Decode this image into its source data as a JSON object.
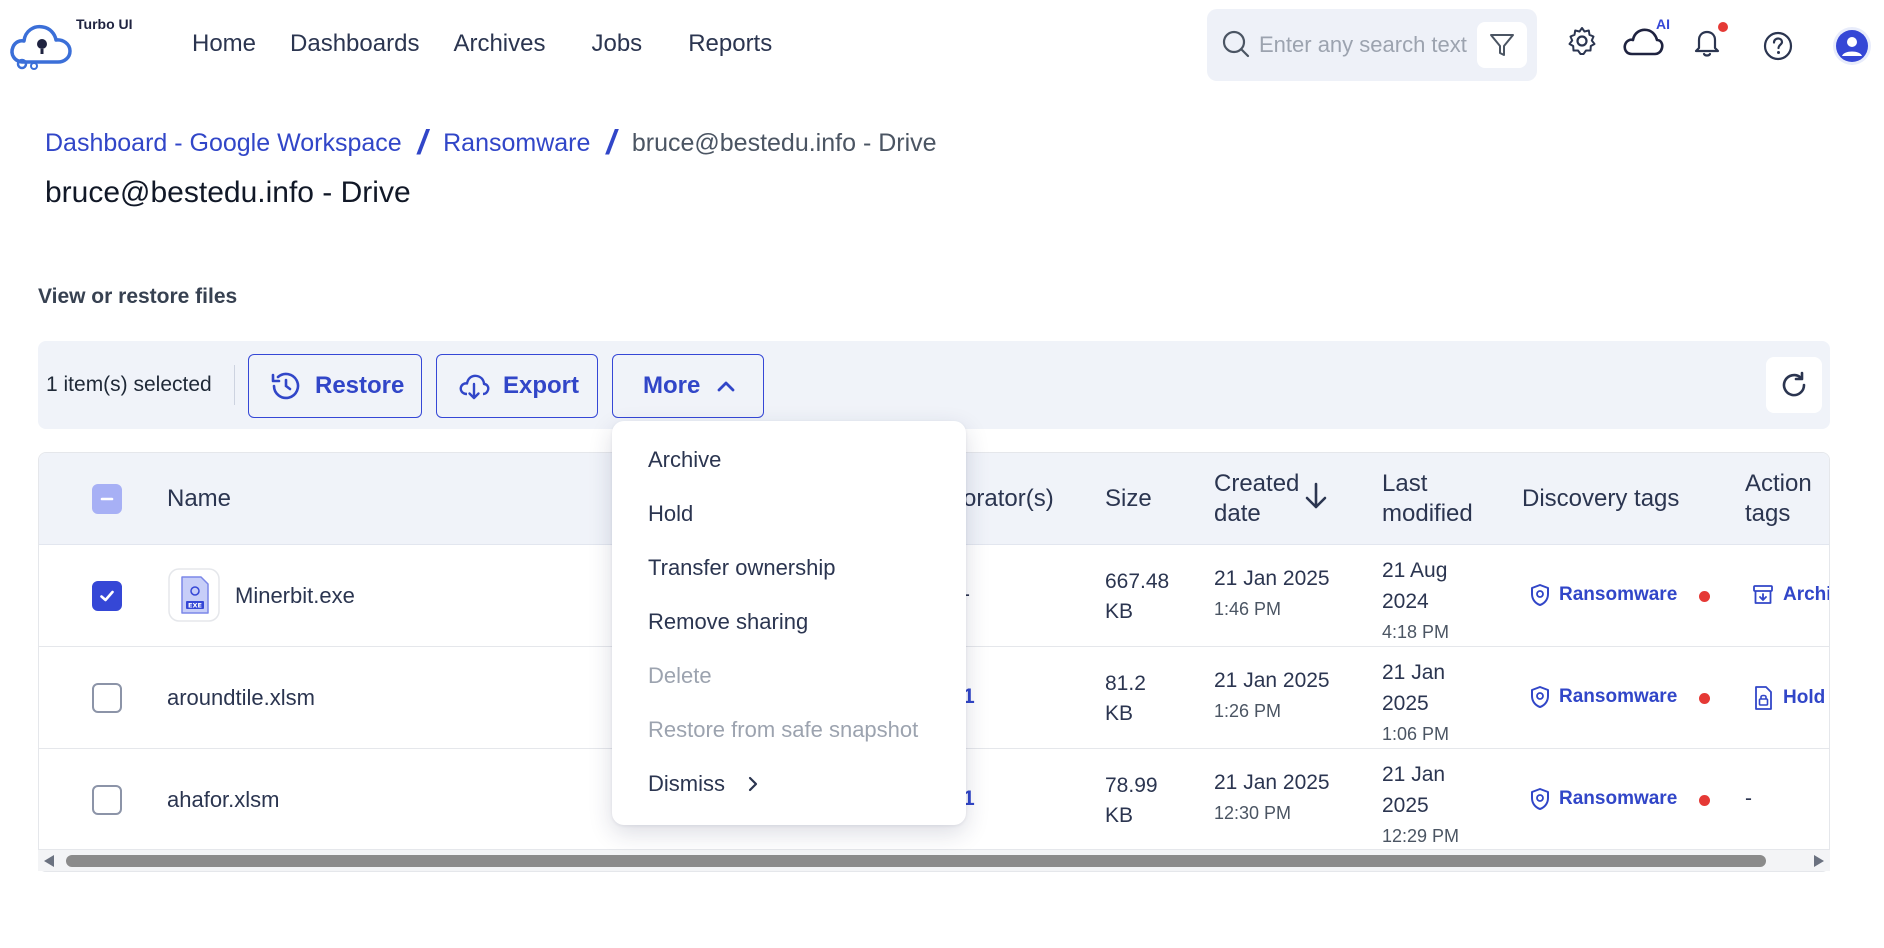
{
  "app": {
    "name": "Turbo UI"
  },
  "nav": {
    "items": [
      "Home",
      "Dashboards",
      "Archives",
      "Jobs",
      "Reports"
    ]
  },
  "search": {
    "placeholder": "Enter any search text"
  },
  "toolbar_icons": {
    "ai_label": "AI",
    "accent": "#3547d6",
    "notification_dot": "#e53935"
  },
  "breadcrumb": {
    "items": [
      "Dashboard - Google Workspace",
      "Ransomware"
    ],
    "current": "bruce@bestedu.info - Drive",
    "separator": "/"
  },
  "page": {
    "title": "bruce@bestedu.info - Drive",
    "section_title": "View or restore files"
  },
  "actions": {
    "selected_count": "1 item(s) selected",
    "restore_label": "Restore",
    "export_label": "Export",
    "more_label": "More"
  },
  "more_menu": {
    "items": [
      {
        "label": "Archive",
        "enabled": true
      },
      {
        "label": "Hold",
        "enabled": true
      },
      {
        "label": "Transfer ownership",
        "enabled": true
      },
      {
        "label": "Remove sharing",
        "enabled": true
      },
      {
        "label": "Delete",
        "enabled": false
      },
      {
        "label": "Restore from safe snapshot",
        "enabled": false
      },
      {
        "label": "Dismiss",
        "enabled": true,
        "submenu": true
      }
    ]
  },
  "table": {
    "columns": {
      "name": "Name",
      "collaborators_partial": "orator(s)",
      "size": "Size",
      "created_line1": "Created",
      "created_line2": "date",
      "modified_line1": "Last",
      "modified_line2": "modified",
      "discovery": "Discovery tags",
      "action_line1": "Action",
      "action_line2": "tags"
    },
    "rows": [
      {
        "name": "Minerbit.exe",
        "selected": true,
        "collab": "-",
        "size_line1": "667.48",
        "size_line2": "KB",
        "created_date": "21 Jan 2025",
        "created_time": "1:46 PM",
        "modified_line1": "21 Aug",
        "modified_line2": "2024",
        "modified_time": "4:18 PM",
        "discovery_tag": "Ransomware",
        "action_tag": "Archi"
      },
      {
        "name": "aroundtile.xlsm",
        "selected": false,
        "collab": "1",
        "size_line1": "81.2",
        "size_line2": "KB",
        "created_date": "21 Jan 2025",
        "created_time": "1:26 PM",
        "modified_line1": "21 Jan",
        "modified_line2": "2025",
        "modified_time": "1:06 PM",
        "discovery_tag": "Ransomware",
        "action_tag": "Hold"
      },
      {
        "name": "ahafor.xlsm",
        "selected": false,
        "collab": "1",
        "size_line1": "78.99",
        "size_line2": "KB",
        "created_date": "21 Jan 2025",
        "created_time": "12:30 PM",
        "modified_line1": "21 Jan",
        "modified_line2": "2025",
        "modified_time": "12:29 PM",
        "discovery_tag": "Ransomware",
        "action_tag": "-"
      }
    ]
  }
}
